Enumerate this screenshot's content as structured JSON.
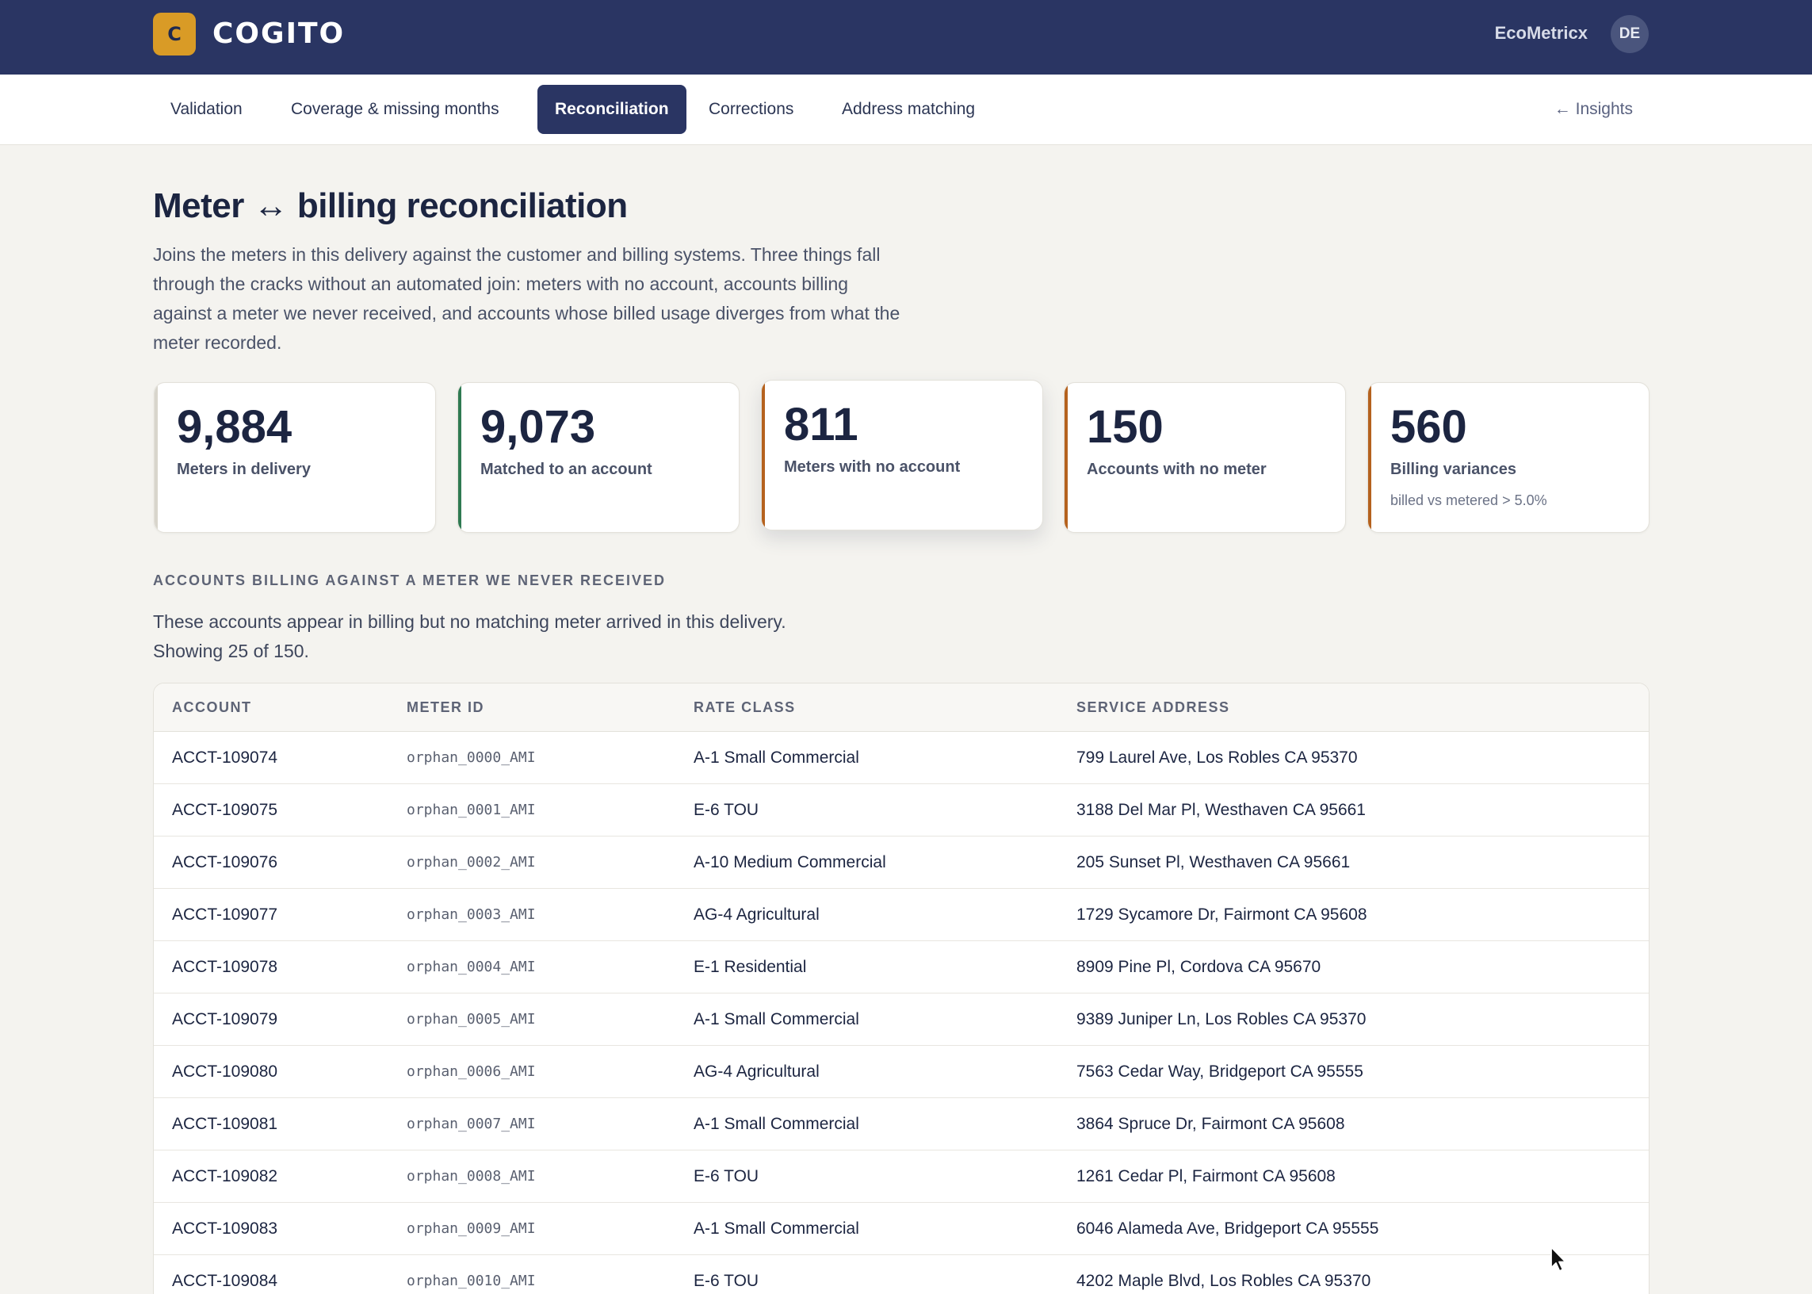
{
  "header": {
    "logo_letter": "C",
    "brand": "COGITO",
    "org": "EcoMetricx",
    "avatar_initials": "DE"
  },
  "nav": {
    "tabs": [
      {
        "label": "Validation",
        "active": false
      },
      {
        "label": "Coverage & missing months",
        "active": false
      },
      {
        "label": "Reconciliation",
        "active": true
      },
      {
        "label": "Corrections",
        "active": false
      },
      {
        "label": "Address matching",
        "active": false
      }
    ],
    "back_link": "← Insights"
  },
  "page": {
    "title": "Meter ↔ billing reconciliation",
    "description": "Joins the meters in this delivery against the customer and billing systems. Three things fall through the cracks without an automated join: meters with no account, accounts billing against a meter we never received, and accounts whose billed usage diverges from what the meter recorded."
  },
  "stats": [
    {
      "value": "9,884",
      "label": "Meters in delivery",
      "sub": "",
      "accent": "#d8d5cc"
    },
    {
      "value": "9,073",
      "label": "Matched to an account",
      "sub": "",
      "accent": "#2f7a52"
    },
    {
      "value": "811",
      "label": "Meters with no account",
      "sub": "",
      "accent": "#b5621e"
    },
    {
      "value": "150",
      "label": "Accounts with no meter",
      "sub": "",
      "accent": "#b5621e"
    },
    {
      "value": "560",
      "label": "Billing variances",
      "sub": "billed vs metered > 5.0%",
      "accent": "#b5621e"
    }
  ],
  "section": {
    "title": "ACCOUNTS BILLING AGAINST A METER WE NEVER RECEIVED",
    "description_line1": "These accounts appear in billing but no matching meter arrived in this delivery.",
    "description_line2": "Showing 25 of 150."
  },
  "table": {
    "columns": [
      "ACCOUNT",
      "METER ID",
      "RATE CLASS",
      "SERVICE ADDRESS"
    ],
    "rows": [
      [
        "ACCT-109074",
        "orphan_0000_AMI",
        "A-1 Small Commercial",
        "799 Laurel Ave, Los Robles CA 95370"
      ],
      [
        "ACCT-109075",
        "orphan_0001_AMI",
        "E-6 TOU",
        "3188 Del Mar Pl, Westhaven CA 95661"
      ],
      [
        "ACCT-109076",
        "orphan_0002_AMI",
        "A-10 Medium Commercial",
        "205 Sunset Pl, Westhaven CA 95661"
      ],
      [
        "ACCT-109077",
        "orphan_0003_AMI",
        "AG-4 Agricultural",
        "1729 Sycamore Dr, Fairmont CA 95608"
      ],
      [
        "ACCT-109078",
        "orphan_0004_AMI",
        "E-1 Residential",
        "8909 Pine Pl, Cordova CA 95670"
      ],
      [
        "ACCT-109079",
        "orphan_0005_AMI",
        "A-1 Small Commercial",
        "9389 Juniper Ln, Los Robles CA 95370"
      ],
      [
        "ACCT-109080",
        "orphan_0006_AMI",
        "AG-4 Agricultural",
        "7563 Cedar Way, Bridgeport CA 95555"
      ],
      [
        "ACCT-109081",
        "orphan_0007_AMI",
        "A-1 Small Commercial",
        "3864 Spruce Dr, Fairmont CA 95608"
      ],
      [
        "ACCT-109082",
        "orphan_0008_AMI",
        "E-6 TOU",
        "1261 Cedar Pl, Fairmont CA 95608"
      ],
      [
        "ACCT-109083",
        "orphan_0009_AMI",
        "A-1 Small Commercial",
        "6046 Alameda Ave, Bridgeport CA 95555"
      ],
      [
        "ACCT-109084",
        "orphan_0010_AMI",
        "E-6 TOU",
        "4202 Maple Blvd, Los Robles CA 95370"
      ]
    ]
  },
  "colors": {
    "header_bg": "#2a3563",
    "logo_bg": "#d99b26",
    "page_bg": "#f4f3ef",
    "success": "#2f7a52",
    "warning": "#b5621e"
  }
}
